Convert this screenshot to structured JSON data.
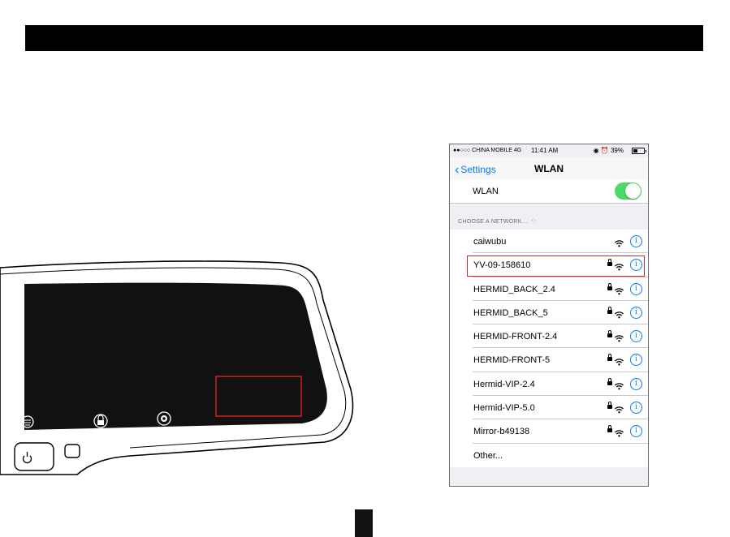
{
  "phone": {
    "status": {
      "carrier": "●●○○○ CHINA MOBILE  4G",
      "time": "11:41 AM",
      "battery": "39%",
      "status_icons": [
        "orientation-lock-icon",
        "alarm-icon",
        "battery-icon"
      ]
    },
    "nav": {
      "back_label": "Settings",
      "title": "WLAN"
    },
    "wlan_toggle": {
      "label": "WLAN",
      "on": true
    },
    "section_header": "CHOOSE A NETWORK...",
    "networks": [
      {
        "name": "caiwubu",
        "secured": false
      },
      {
        "name": "YV-09-158610",
        "secured": true,
        "highlighted": true
      },
      {
        "name": "HERMID_BACK_2.4",
        "secured": true
      },
      {
        "name": "HERMID_BACK_5",
        "secured": true
      },
      {
        "name": "HERMID-FRONT-2.4",
        "secured": true
      },
      {
        "name": "HERMID-FRONT-5",
        "secured": true
      },
      {
        "name": "Hermid-VIP-2.4",
        "secured": true
      },
      {
        "name": "Hermid-VIP-5.0",
        "secured": true
      },
      {
        "name": "Mirror-b49138",
        "secured": true
      },
      {
        "name": "Other...",
        "secured": false,
        "other": true
      }
    ]
  },
  "device": {
    "buttons": [
      "menu-icon",
      "lock-icon",
      "settings-icon",
      "power-icon",
      "square-button"
    ],
    "highlight_color": "#e02020"
  },
  "colors": {
    "accent": "#007aff",
    "toggle_on": "#4cd964",
    "highlight": "#e02020"
  }
}
